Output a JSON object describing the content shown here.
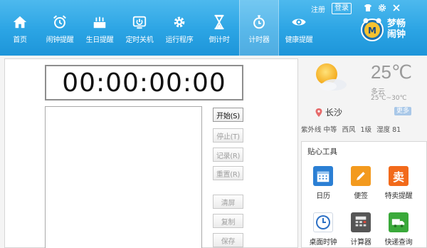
{
  "nav": [
    {
      "label": "首页",
      "icon": "home-icon"
    },
    {
      "label": "闹钟提醒",
      "icon": "alarm-clock-icon"
    },
    {
      "label": "生日提醒",
      "icon": "birthday-cake-icon"
    },
    {
      "label": "定时关机",
      "icon": "power-icon"
    },
    {
      "label": "运行程序",
      "icon": "gear-icon"
    },
    {
      "label": "倒计时",
      "icon": "hourglass-icon"
    },
    {
      "label": "计时器",
      "icon": "stopwatch-icon",
      "active": true
    },
    {
      "label": "健康提醒",
      "icon": "eye-icon"
    }
  ],
  "toplinks": {
    "register": "注册",
    "login": "登录"
  },
  "window_controls": [
    "shirt-icon",
    "settings-icon",
    "close-icon"
  ],
  "brand": {
    "line1": "梦畅",
    "line2": "闹钟"
  },
  "timer": {
    "display": "00:00:00:00",
    "buttons": {
      "start": "开始(S)",
      "stop": "停止(T)",
      "record": "记录(R)",
      "reset": "重置(R)",
      "clear": "清屏",
      "copy": "复制",
      "save": "保存"
    }
  },
  "weather": {
    "temperature": "25℃",
    "condition": "多云",
    "range": "25℃~30℃",
    "city": "长沙",
    "more": "更多",
    "uv": "紫外线 中等",
    "wind_dir": "西风",
    "wind_level": "1级",
    "humidity": "湿度 81"
  },
  "tools": {
    "title": "贴心工具",
    "items": [
      {
        "label": "日历",
        "icon": "calendar-icon",
        "color": "#2b7fd4"
      },
      {
        "label": "便签",
        "icon": "pencil-icon",
        "color": "#f39a1e"
      },
      {
        "label": "特卖提醒",
        "icon": "sale-icon",
        "color": "#f26a1b",
        "glyph": "卖"
      },
      {
        "label": "桌面时钟",
        "icon": "desktop-clock-icon",
        "color": "#2b6fc4"
      },
      {
        "label": "计算器",
        "icon": "calculator-icon",
        "color": "#555555"
      },
      {
        "label": "快递查询",
        "icon": "truck-icon",
        "color": "#3aa93a"
      }
    ]
  },
  "colors": {
    "accent": "#2ba4e4"
  }
}
